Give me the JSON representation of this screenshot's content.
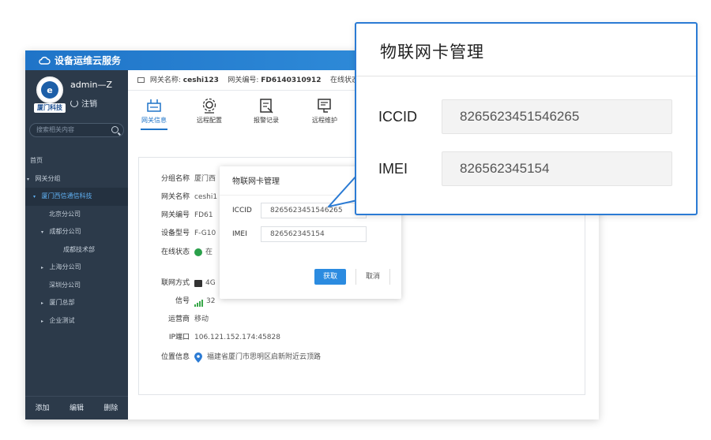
{
  "app": {
    "title": "设备运维云服务",
    "user": {
      "name": "admin—Z",
      "logout_label": "注销",
      "avatar_caption": "厦门科技",
      "avatar_glyph": "e"
    },
    "search": {
      "placeholder": "搜索相关内容"
    },
    "nav": [
      {
        "label": "首页",
        "indent": 0,
        "caret": ""
      },
      {
        "label": "网关分组",
        "indent": 0,
        "caret": "▾"
      },
      {
        "label": "厦门西信通信科技",
        "indent": 1,
        "caret": "▾",
        "active": true
      },
      {
        "label": "北京分公司",
        "indent": 2,
        "caret": ""
      },
      {
        "label": "成都分公司",
        "indent": 2,
        "caret": "▾"
      },
      {
        "label": "成都技术部",
        "indent": 3,
        "caret": ""
      },
      {
        "label": "上海分公司",
        "indent": 2,
        "caret": "▸"
      },
      {
        "label": "深圳分公司",
        "indent": 2,
        "caret": ""
      },
      {
        "label": "厦门总部",
        "indent": 2,
        "caret": "▸"
      },
      {
        "label": "企业测试",
        "indent": 2,
        "caret": "▸"
      }
    ],
    "footer": [
      "添加",
      "编辑",
      "删除"
    ],
    "infobar": {
      "name_label": "网关名称:",
      "name_value": "ceshi123",
      "id_label": "网关编号:",
      "id_value": "FD6140310912",
      "status_label": "在线状态"
    },
    "tools": [
      {
        "label": "网关信息",
        "icon": "gateway-icon"
      },
      {
        "label": "远程配置",
        "icon": "remote-config-icon"
      },
      {
        "label": "报警记录",
        "icon": "alarm-record-icon"
      },
      {
        "label": "远程维护",
        "icon": "remote-maintain-icon"
      }
    ],
    "details": [
      {
        "key": "分组名称",
        "value": "厦门西"
      },
      {
        "key": "网关名称",
        "value": "ceshi1"
      },
      {
        "key": "网关编号",
        "value": "FD61"
      },
      {
        "key": "设备型号",
        "value": "F-G10"
      },
      {
        "key": "在线状态",
        "value": "在"
      },
      {
        "key": "联网方式",
        "value": "4G"
      },
      {
        "key": "信号",
        "value": "32"
      },
      {
        "key": "运营商",
        "value": "移动"
      },
      {
        "key": "IP端口",
        "value": "106.121.152.174:45828"
      },
      {
        "key": "位置信息",
        "value": "福建省厦门市思明区启新附近云顶路"
      }
    ],
    "dialog": {
      "title": "物联网卡管理",
      "iccid_label": "ICCID",
      "iccid_value": "8265623451546265",
      "imei_label": "IMEI",
      "imei_value": "826562345154",
      "ok_label": "获取",
      "cancel_label": "取消"
    }
  },
  "callout": {
    "title": "物联网卡管理",
    "iccid_label": "ICCID",
    "iccid_value": "8265623451546265",
    "imei_label": "IMEI",
    "imei_value": "826562345154"
  },
  "colors": {
    "accent": "#2b7bd4",
    "sidebar": "#2c3a4a",
    "active_link": "#5fb0f2",
    "online": "#2aa04a",
    "signal": "#3aa84a"
  }
}
